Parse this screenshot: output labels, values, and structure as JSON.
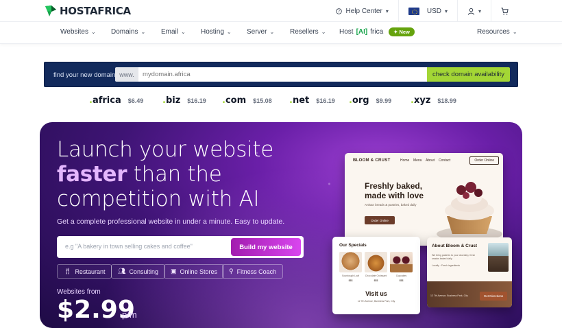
{
  "brand": {
    "name": "HOSTAFRICA"
  },
  "topbar": {
    "help_label": "Help Center",
    "currency_label": "USD"
  },
  "nav": {
    "items": [
      "Websites",
      "Domains",
      "Email",
      "Hosting",
      "Server",
      "Resellers"
    ],
    "ai_prefix": "Host",
    "ai_bracket": "[AI]",
    "ai_suffix": "frica",
    "ai_badge": "New",
    "resources": "Resources"
  },
  "domain_search": {
    "label": "find your new domain",
    "prefix": "www.",
    "placeholder": "mydomain.africa",
    "button": "check domain availability"
  },
  "tlds": [
    {
      "name": "africa",
      "price": "$6.49"
    },
    {
      "name": "biz",
      "price": "$16.19"
    },
    {
      "name": "com",
      "price": "$15.08"
    },
    {
      "name": "net",
      "price": "$16.19"
    },
    {
      "name": "org",
      "price": "$9.99"
    },
    {
      "name": "xyz",
      "price": "$18.99"
    }
  ],
  "hero": {
    "line1": "Launch your website",
    "line2_accent": "faster",
    "line2_rest": " than the",
    "line3": "competition with AI",
    "subtitle": "Get a complete professional website in under a minute. Easy to update.",
    "prompt_placeholder": "e.g \"A bakery in town selling cakes and coffee\"",
    "build_button": "Build my website",
    "chips": [
      "Restaurant",
      "Consulting",
      "Online Stores",
      "Fitness Coach"
    ],
    "from_label": "Websites from",
    "price": "$2.99",
    "price_unit": "p/m"
  },
  "mockup": {
    "brand": "BLOOM & CRUST",
    "links": [
      "Home",
      "Menu",
      "About",
      "Contact"
    ],
    "order": "Order Online",
    "headline": "Freshly baked, made with love",
    "desc": "Artisan breads & pastries, baked daily",
    "cta": "Order Online",
    "specials_title": "Our Specials",
    "specials": [
      {
        "name": "Sourdough Loaf",
        "price": "$$$"
      },
      {
        "name": "Chocolate Croissant",
        "price": "$$$"
      },
      {
        "name": "Cupcakes",
        "price": "$$$"
      }
    ],
    "visit_title": "Visit us",
    "visit_addr": "12 7th Avenue, Business Park, City",
    "about_title": "About Bloom & Crust",
    "about_text": "We bring pastries to your doorstep, fresh snacks baked daily.",
    "about_sub": "Locally · Fresh ingredients",
    "about_addr": "12 7th Avenue, Business Park, City",
    "directions": "Get Directions"
  },
  "colors": {
    "navy": "#122a5c",
    "lime": "#a3d635",
    "green": "#16a34a",
    "hero_purple": "#6a1fa8",
    "build_magenta": "#d946ef"
  }
}
